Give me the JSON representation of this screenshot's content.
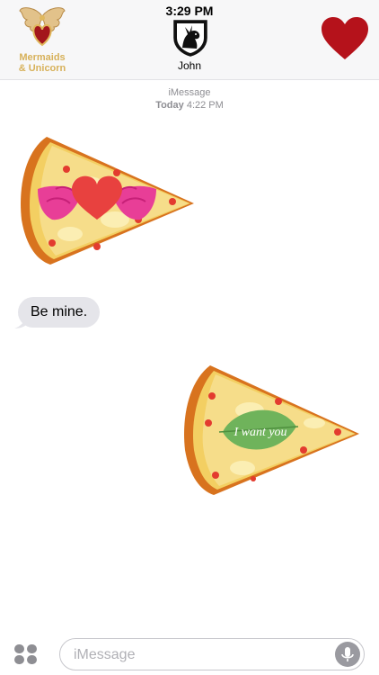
{
  "status_bar": {
    "time": "3:29 PM"
  },
  "header": {
    "app_brand": {
      "line1": "Mermaids",
      "line2": "& Unicorn"
    },
    "contact_name": "John",
    "heart_icon": "heart-icon"
  },
  "conversation": {
    "service_label": "iMessage",
    "day_label": "Today",
    "time_label": "4:22 PM",
    "messages": [
      {
        "type": "sticker",
        "from": "contact",
        "icon": "pizza-heart-wings-sticker"
      },
      {
        "type": "text",
        "from": "contact",
        "text": "Be mine."
      },
      {
        "type": "sticker",
        "from": "me",
        "icon": "pizza-leaf-sticker",
        "sticker_text": "I want you"
      }
    ]
  },
  "compose": {
    "placeholder": "iMessage",
    "apps_icon": "app-drawer-icon",
    "mic_icon": "microphone-icon"
  },
  "colors": {
    "heart_red": "#b5121b",
    "bubble_gray": "#e5e5ea",
    "brand_gold": "#d7b15a",
    "leaf_green": "#6fb35b",
    "wing_pink": "#e83e97"
  }
}
